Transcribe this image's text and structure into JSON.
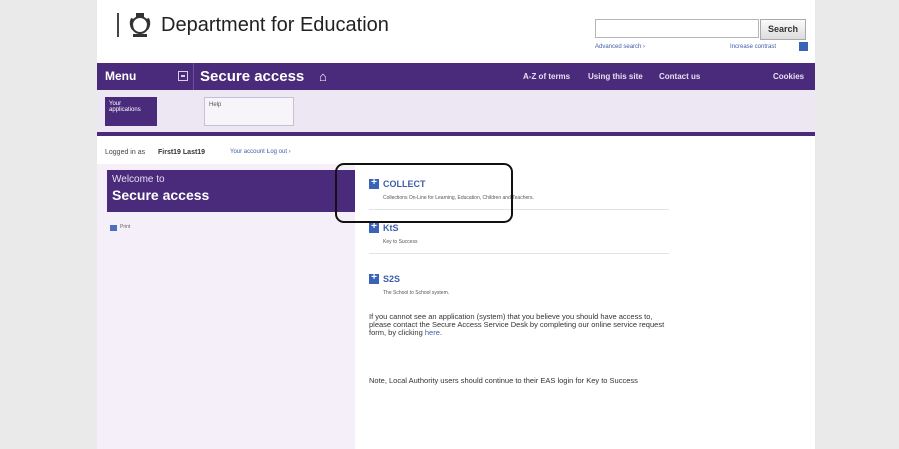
{
  "header": {
    "title": "Department for Education",
    "search_button": "Search",
    "search_value": "",
    "advanced_search": "Advanced search ›",
    "contrast_link": "Increase contrast"
  },
  "nav": {
    "menu": "Menu",
    "section": "Secure access",
    "links": [
      "A-Z of terms",
      "Using this site",
      "Contact us",
      "Cookies"
    ]
  },
  "tabs": [
    "Your applications",
    "Help"
  ],
  "login_bar": {
    "prefix": "Logged in as",
    "user": "First19 Last19",
    "account": "Your account ›",
    "logout": "Log out ›"
  },
  "left": {
    "welcome_small": "Welcome to",
    "welcome_big": "Secure access",
    "print": "Print"
  },
  "apps": [
    {
      "title": "COLLECT",
      "desc": "Collections On-Line for Learning, Education, Children and Teachers."
    },
    {
      "title": "KtS",
      "desc": "Key to Success"
    },
    {
      "title": "S2S",
      "desc": "The School to School system."
    }
  ],
  "info": {
    "para1": "If you cannot see an application (system) that you believe you should have access to, please contact the Secure Access Service Desk by completing our online service request form, by clicking",
    "here": "here",
    "para2": "Note, Local Authority users should continue to their EAS login for Key to Success"
  },
  "colors": {
    "brand_purple": "#4a2a7a",
    "link_blue": "#3f5ea8",
    "page_bg": "#eaeaea"
  }
}
